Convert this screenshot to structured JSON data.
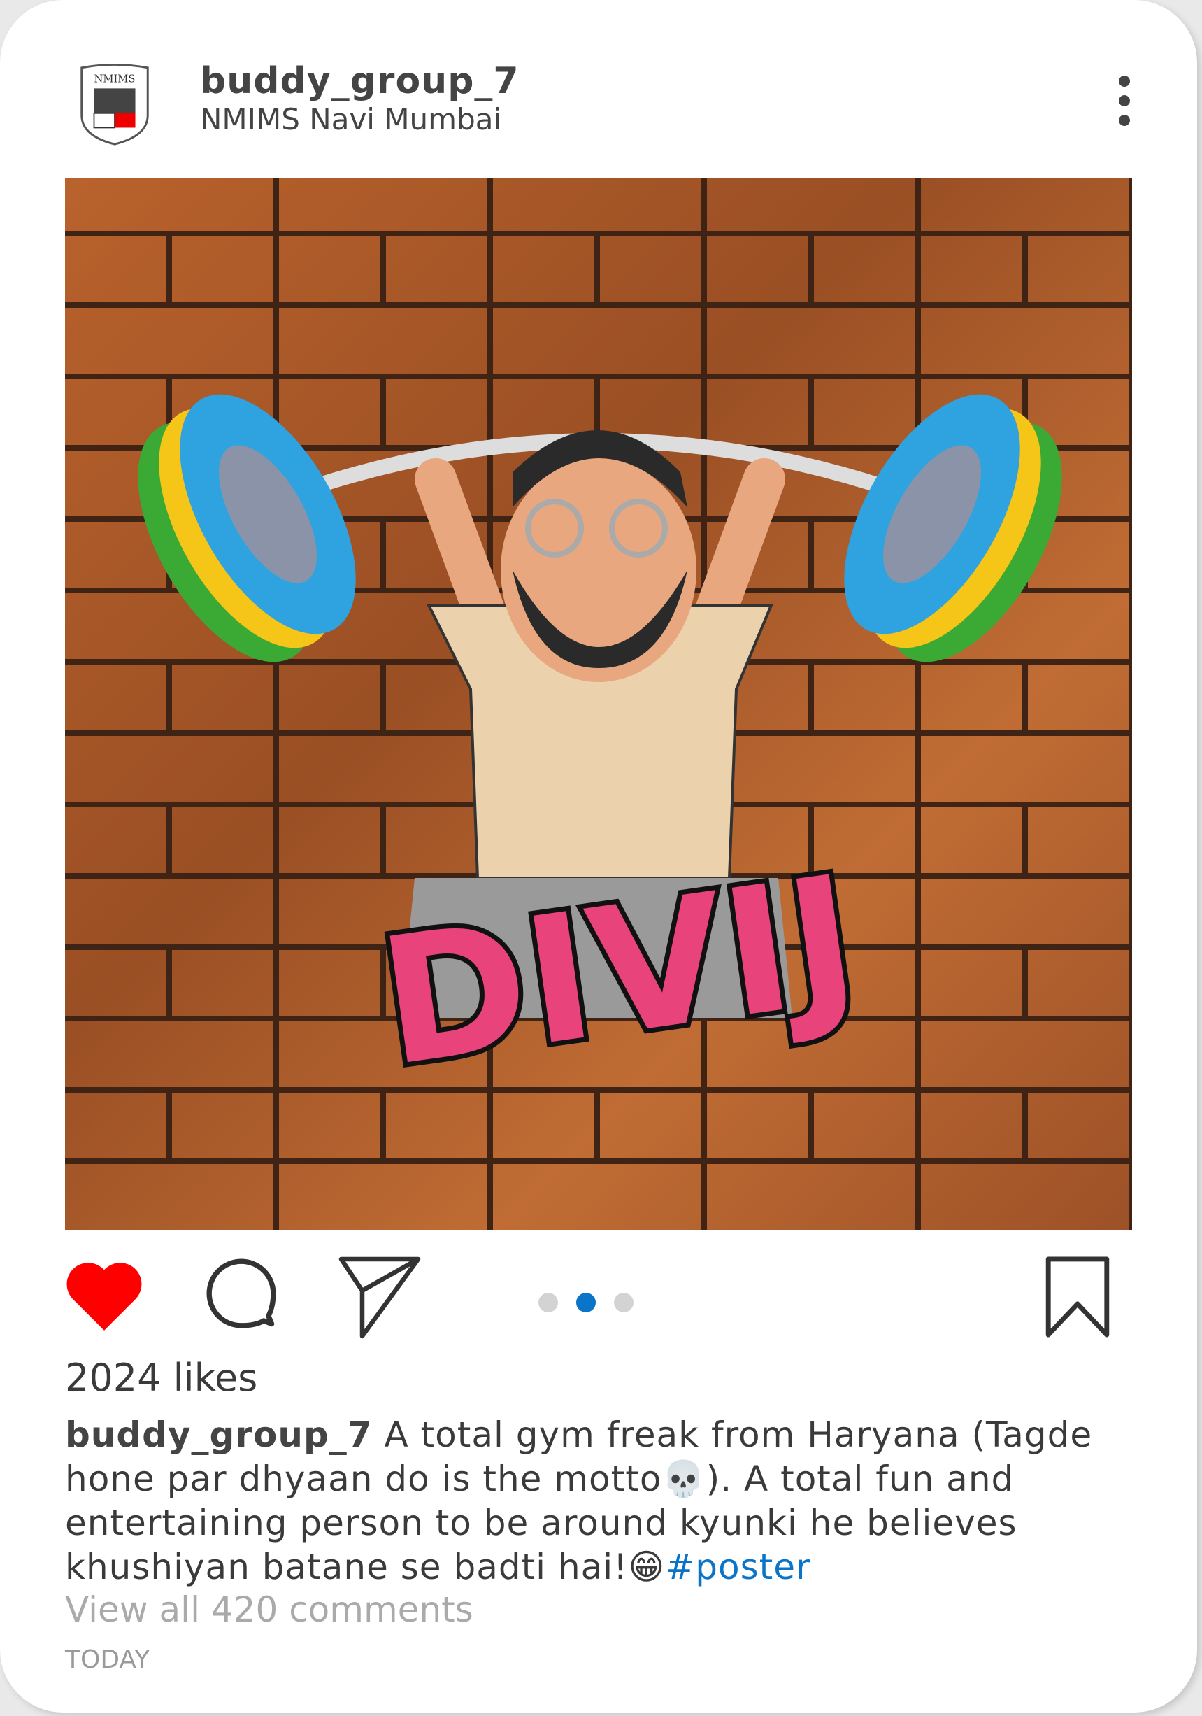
{
  "post": {
    "username": "buddy_group_7",
    "location": "NMIMS Navi Mumbai",
    "logo_text": "NMIMS",
    "likes": "2024 likes",
    "caption_user": "buddy_group_7",
    "caption_text": " A total gym freak from Haryana (Tagde hone par dhyaan do is the motto💀). A total fun and entertaining person to be around kyunki he believes khushiyan batane se badti hai!😁",
    "hashtag": "#poster",
    "view_comments": "View all 420 comments",
    "timestamp": "TODAY",
    "image_text": "DIVIJ",
    "carousel": {
      "count": 3,
      "active_index": 1
    }
  },
  "icons": [
    "logo",
    "more-vertical-icon",
    "heart-icon",
    "comment-icon",
    "share-icon",
    "bookmark-icon"
  ],
  "colors": {
    "like": "#ff0000",
    "accent": "#0a74c9",
    "text": "#3a3a3a",
    "muted": "#aaaaaa"
  }
}
